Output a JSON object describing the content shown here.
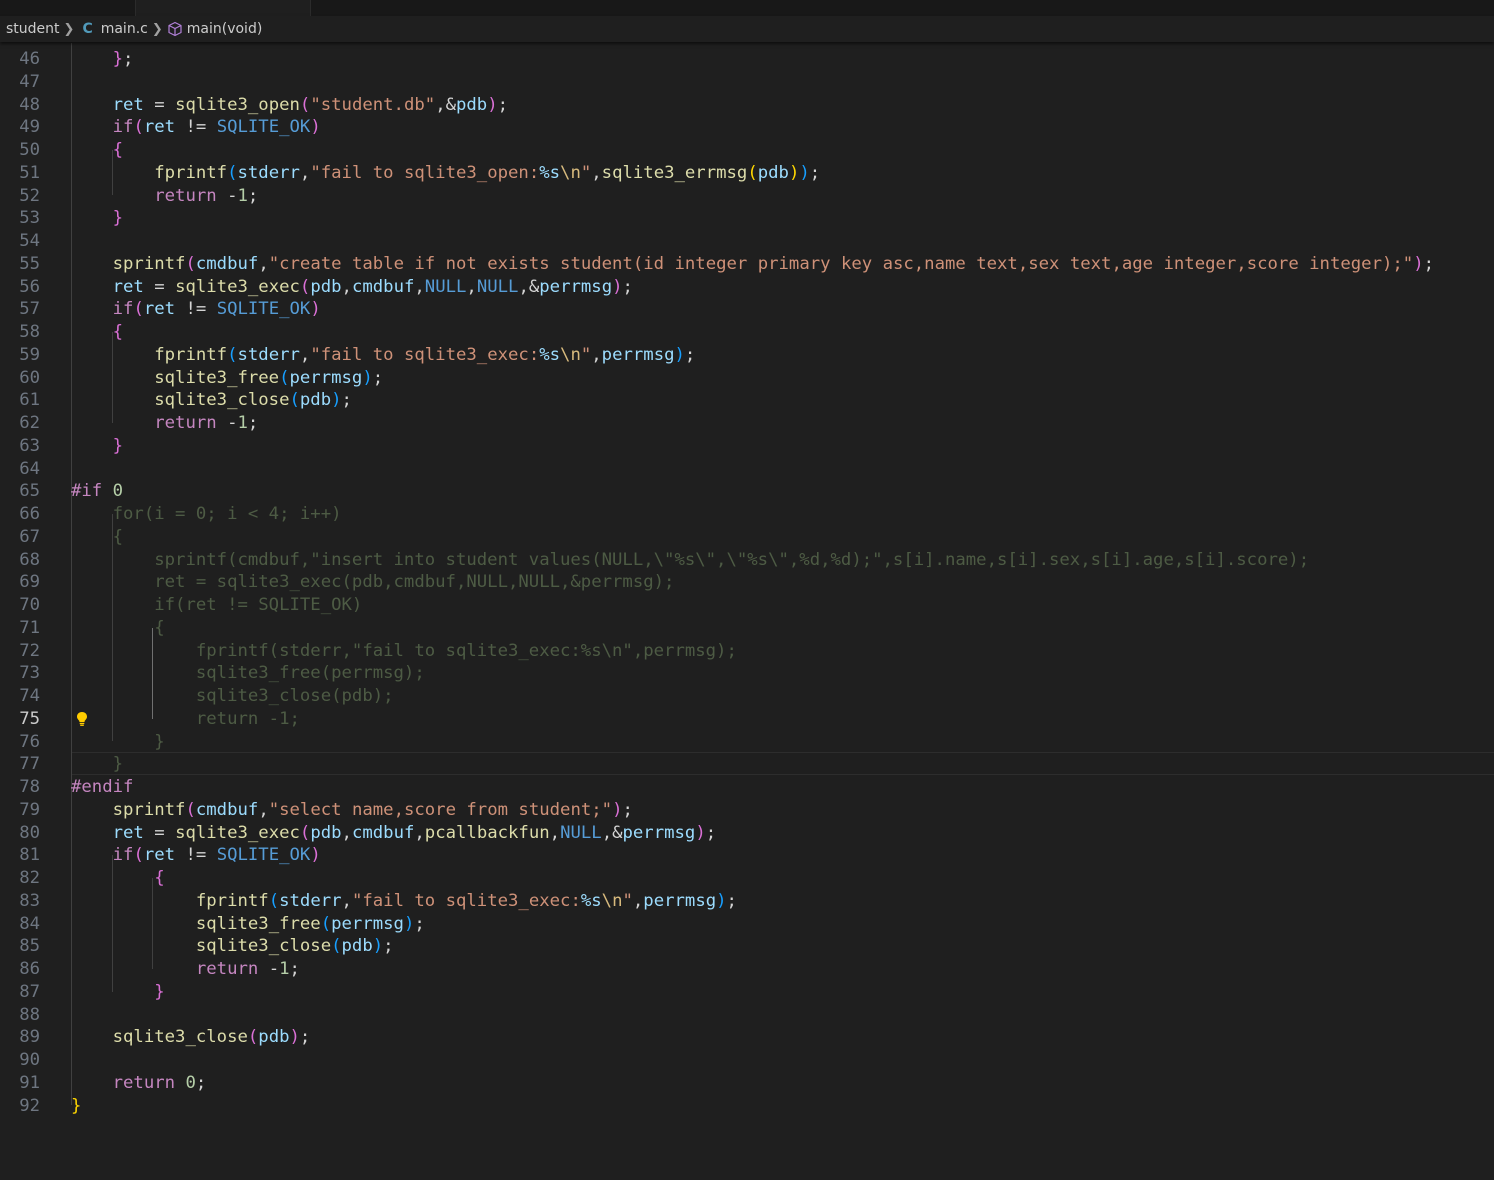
{
  "breadcrumb": {
    "folder": "student",
    "file": "main.c",
    "file_icon": "C",
    "symbol": "main(void)"
  },
  "editor": {
    "current_line": 75,
    "lines": [
      {
        "n": "46",
        "t": [
          [
            "op",
            "    "
          ],
          [
            "p2",
            "}"
          ],
          [
            "op",
            ";"
          ]
        ]
      },
      {
        "n": "47",
        "t": []
      },
      {
        "n": "48",
        "t": [
          [
            "op",
            "    "
          ],
          [
            "var",
            "ret"
          ],
          [
            "op",
            " = "
          ],
          [
            "fn",
            "sqlite3_open"
          ],
          [
            "p2",
            "("
          ],
          [
            "str",
            "\"student.db\""
          ],
          [
            "op",
            ","
          ],
          [
            "op",
            "&"
          ],
          [
            "var",
            "pdb"
          ],
          [
            "p2",
            ")"
          ],
          [
            "op",
            ";"
          ]
        ]
      },
      {
        "n": "49",
        "t": [
          [
            "op",
            "    "
          ],
          [
            "kw",
            "if"
          ],
          [
            "p2",
            "("
          ],
          [
            "var",
            "ret"
          ],
          [
            "op",
            " != "
          ],
          [
            "mac",
            "SQLITE_OK"
          ],
          [
            "p2",
            ")"
          ]
        ]
      },
      {
        "n": "50",
        "t": [
          [
            "op",
            "    "
          ],
          [
            "p2",
            "{"
          ]
        ]
      },
      {
        "n": "51",
        "t": [
          [
            "op",
            "        "
          ],
          [
            "fn",
            "fprintf"
          ],
          [
            "p3",
            "("
          ],
          [
            "var",
            "stderr"
          ],
          [
            "op",
            ","
          ],
          [
            "str",
            "\"fail to sqlite3_open:"
          ],
          [
            "fmt",
            "%s"
          ],
          [
            "esc",
            "\\n"
          ],
          [
            "str",
            "\""
          ],
          [
            "op",
            ","
          ],
          [
            "fn",
            "sqlite3_errmsg"
          ],
          [
            "p1",
            "("
          ],
          [
            "var",
            "pdb"
          ],
          [
            "p1",
            ")"
          ],
          [
            "p3",
            ")"
          ],
          [
            "op",
            ";"
          ]
        ]
      },
      {
        "n": "52",
        "t": [
          [
            "op",
            "        "
          ],
          [
            "kw",
            "return"
          ],
          [
            "op",
            " -"
          ],
          [
            "num",
            "1"
          ],
          [
            "op",
            ";"
          ]
        ]
      },
      {
        "n": "53",
        "t": [
          [
            "op",
            "    "
          ],
          [
            "p2",
            "}"
          ]
        ]
      },
      {
        "n": "54",
        "t": []
      },
      {
        "n": "55",
        "t": [
          [
            "op",
            "    "
          ],
          [
            "fn",
            "sprintf"
          ],
          [
            "p2",
            "("
          ],
          [
            "var",
            "cmdbuf"
          ],
          [
            "op",
            ","
          ],
          [
            "str",
            "\"create table if not exists student(id integer primary key asc,name text,sex text,age integer,score integer);\""
          ],
          [
            "p2",
            ")"
          ],
          [
            "op",
            ";"
          ]
        ]
      },
      {
        "n": "56",
        "t": [
          [
            "op",
            "    "
          ],
          [
            "var",
            "ret"
          ],
          [
            "op",
            " = "
          ],
          [
            "fn",
            "sqlite3_exec"
          ],
          [
            "p2",
            "("
          ],
          [
            "var",
            "pdb"
          ],
          [
            "op",
            ","
          ],
          [
            "var",
            "cmdbuf"
          ],
          [
            "op",
            ","
          ],
          [
            "mac",
            "NULL"
          ],
          [
            "op",
            ","
          ],
          [
            "mac",
            "NULL"
          ],
          [
            "op",
            ",&"
          ],
          [
            "var",
            "perrmsg"
          ],
          [
            "p2",
            ")"
          ],
          [
            "op",
            ";"
          ]
        ]
      },
      {
        "n": "57",
        "t": [
          [
            "op",
            "    "
          ],
          [
            "kw",
            "if"
          ],
          [
            "p2",
            "("
          ],
          [
            "var",
            "ret"
          ],
          [
            "op",
            " != "
          ],
          [
            "mac",
            "SQLITE_OK"
          ],
          [
            "p2",
            ")"
          ]
        ]
      },
      {
        "n": "58",
        "t": [
          [
            "op",
            "    "
          ],
          [
            "p2",
            "{"
          ]
        ]
      },
      {
        "n": "59",
        "t": [
          [
            "op",
            "        "
          ],
          [
            "fn",
            "fprintf"
          ],
          [
            "p3",
            "("
          ],
          [
            "var",
            "stderr"
          ],
          [
            "op",
            ","
          ],
          [
            "str",
            "\"fail to sqlite3_exec:"
          ],
          [
            "fmt",
            "%s"
          ],
          [
            "esc",
            "\\n"
          ],
          [
            "str",
            "\""
          ],
          [
            "op",
            ","
          ],
          [
            "var",
            "perrmsg"
          ],
          [
            "p3",
            ")"
          ],
          [
            "op",
            ";"
          ]
        ]
      },
      {
        "n": "60",
        "t": [
          [
            "op",
            "        "
          ],
          [
            "fn",
            "sqlite3_free"
          ],
          [
            "p3",
            "("
          ],
          [
            "var",
            "perrmsg"
          ],
          [
            "p3",
            ")"
          ],
          [
            "op",
            ";"
          ]
        ]
      },
      {
        "n": "61",
        "t": [
          [
            "op",
            "        "
          ],
          [
            "fn",
            "sqlite3_close"
          ],
          [
            "p3",
            "("
          ],
          [
            "var",
            "pdb"
          ],
          [
            "p3",
            ")"
          ],
          [
            "op",
            ";"
          ]
        ]
      },
      {
        "n": "62",
        "t": [
          [
            "op",
            "        "
          ],
          [
            "kw",
            "return"
          ],
          [
            "op",
            " -"
          ],
          [
            "num",
            "1"
          ],
          [
            "op",
            ";"
          ]
        ]
      },
      {
        "n": "63",
        "t": [
          [
            "op",
            "    "
          ],
          [
            "p2",
            "}"
          ]
        ]
      },
      {
        "n": "64",
        "t": []
      },
      {
        "n": "65",
        "t": [
          [
            "pp",
            "#if"
          ],
          [
            "op",
            " "
          ],
          [
            "num",
            "0"
          ]
        ]
      },
      {
        "n": "66",
        "t": [
          [
            "dim",
            "    for(i = 0; i < 4; i++)"
          ]
        ]
      },
      {
        "n": "67",
        "t": [
          [
            "dim",
            "    {"
          ]
        ]
      },
      {
        "n": "68",
        "t": [
          [
            "dim",
            "        sprintf(cmdbuf,\"insert into student values(NULL,\\\"%s\\\",\\\"%s\\\",%d,%d);\",s[i].name,s[i].sex,s[i].age,s[i].score);"
          ]
        ]
      },
      {
        "n": "69",
        "t": [
          [
            "dim",
            "        ret = sqlite3_exec(pdb,cmdbuf,NULL,NULL,&perrmsg);"
          ]
        ]
      },
      {
        "n": "70",
        "t": [
          [
            "dim",
            "        if(ret != SQLITE_OK)"
          ]
        ]
      },
      {
        "n": "71",
        "t": [
          [
            "dim",
            "        {"
          ]
        ]
      },
      {
        "n": "72",
        "t": [
          [
            "dim",
            "            fprintf(stderr,\"fail to sqlite3_exec:%s\\n\",perrmsg);"
          ]
        ]
      },
      {
        "n": "73",
        "t": [
          [
            "dim",
            "            sqlite3_free(perrmsg);"
          ]
        ]
      },
      {
        "n": "74",
        "t": [
          [
            "dim",
            "            sqlite3_close(pdb);"
          ]
        ]
      },
      {
        "n": "75",
        "t": [
          [
            "dim",
            "            return -1;"
          ]
        ]
      },
      {
        "n": "76",
        "t": [
          [
            "dim",
            "        }"
          ]
        ]
      },
      {
        "n": "77",
        "t": [
          [
            "dim",
            "    }"
          ]
        ]
      },
      {
        "n": "78",
        "t": [
          [
            "pp",
            "#endif"
          ]
        ]
      },
      {
        "n": "79",
        "t": [
          [
            "op",
            "    "
          ],
          [
            "fn",
            "sprintf"
          ],
          [
            "p2",
            "("
          ],
          [
            "var",
            "cmdbuf"
          ],
          [
            "op",
            ","
          ],
          [
            "str",
            "\"select name,score from student;\""
          ],
          [
            "p2",
            ")"
          ],
          [
            "op",
            ";"
          ]
        ]
      },
      {
        "n": "80",
        "t": [
          [
            "op",
            "    "
          ],
          [
            "var",
            "ret"
          ],
          [
            "op",
            " = "
          ],
          [
            "fn",
            "sqlite3_exec"
          ],
          [
            "p2",
            "("
          ],
          [
            "var",
            "pdb"
          ],
          [
            "op",
            ","
          ],
          [
            "var",
            "cmdbuf"
          ],
          [
            "op",
            ","
          ],
          [
            "fn",
            "pcallbackfun"
          ],
          [
            "op",
            ","
          ],
          [
            "mac",
            "NULL"
          ],
          [
            "op",
            ",&"
          ],
          [
            "var",
            "perrmsg"
          ],
          [
            "p2",
            ")"
          ],
          [
            "op",
            ";"
          ]
        ]
      },
      {
        "n": "81",
        "t": [
          [
            "op",
            "    "
          ],
          [
            "kw",
            "if"
          ],
          [
            "p2",
            "("
          ],
          [
            "var",
            "ret"
          ],
          [
            "op",
            " != "
          ],
          [
            "mac",
            "SQLITE_OK"
          ],
          [
            "p2",
            ")"
          ]
        ]
      },
      {
        "n": "82",
        "t": [
          [
            "op",
            "        "
          ],
          [
            "p2",
            "{"
          ]
        ]
      },
      {
        "n": "83",
        "t": [
          [
            "op",
            "            "
          ],
          [
            "fn",
            "fprintf"
          ],
          [
            "p3",
            "("
          ],
          [
            "var",
            "stderr"
          ],
          [
            "op",
            ","
          ],
          [
            "str",
            "\"fail to sqlite3_exec:"
          ],
          [
            "fmt",
            "%s"
          ],
          [
            "esc",
            "\\n"
          ],
          [
            "str",
            "\""
          ],
          [
            "op",
            ","
          ],
          [
            "var",
            "perrmsg"
          ],
          [
            "p3",
            ")"
          ],
          [
            "op",
            ";"
          ]
        ]
      },
      {
        "n": "84",
        "t": [
          [
            "op",
            "            "
          ],
          [
            "fn",
            "sqlite3_free"
          ],
          [
            "p3",
            "("
          ],
          [
            "var",
            "perrmsg"
          ],
          [
            "p3",
            ")"
          ],
          [
            "op",
            ";"
          ]
        ]
      },
      {
        "n": "85",
        "t": [
          [
            "op",
            "            "
          ],
          [
            "fn",
            "sqlite3_close"
          ],
          [
            "p3",
            "("
          ],
          [
            "var",
            "pdb"
          ],
          [
            "p3",
            ")"
          ],
          [
            "op",
            ";"
          ]
        ]
      },
      {
        "n": "86",
        "t": [
          [
            "op",
            "            "
          ],
          [
            "kw",
            "return"
          ],
          [
            "op",
            " -"
          ],
          [
            "num",
            "1"
          ],
          [
            "op",
            ";"
          ]
        ]
      },
      {
        "n": "87",
        "t": [
          [
            "op",
            "        "
          ],
          [
            "p2",
            "}"
          ]
        ]
      },
      {
        "n": "88",
        "t": []
      },
      {
        "n": "89",
        "t": [
          [
            "op",
            "    "
          ],
          [
            "fn",
            "sqlite3_close"
          ],
          [
            "p2",
            "("
          ],
          [
            "var",
            "pdb"
          ],
          [
            "p2",
            ")"
          ],
          [
            "op",
            ";"
          ]
        ]
      },
      {
        "n": "90",
        "t": []
      },
      {
        "n": "91",
        "t": [
          [
            "op",
            "    "
          ],
          [
            "kw",
            "return"
          ],
          [
            "op",
            " "
          ],
          [
            "num",
            "0"
          ],
          [
            "op",
            ";"
          ]
        ]
      },
      {
        "n": "92",
        "t": [
          [
            "p1",
            "}"
          ]
        ]
      }
    ]
  }
}
